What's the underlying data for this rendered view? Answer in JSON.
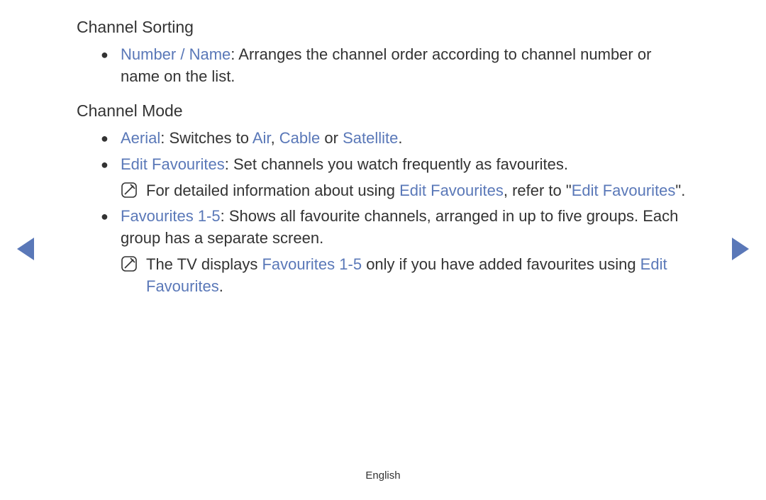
{
  "section1": {
    "heading": "Channel Sorting",
    "item1": {
      "label": "Number / Name",
      "text": ": Arranges the channel order according to channel number or name on the list."
    }
  },
  "section2": {
    "heading": "Channel Mode",
    "aerial": {
      "label": "Aerial",
      "t1": ": Switches to ",
      "opt1": "Air",
      "sep1": ", ",
      "opt2": "Cable",
      "sep2": " or ",
      "opt3": "Satellite",
      "tail": "."
    },
    "editfav": {
      "label": "Edit Favourites",
      "text": ": Set channels you watch frequently as favourites."
    },
    "note1": {
      "t1": "For detailed information about using ",
      "hl1": "Edit Favourites",
      "t2": ", refer to \"",
      "hl2": "Edit Favourites",
      "t3": "\"."
    },
    "fav15": {
      "label": "Favourites 1-5",
      "text": ": Shows all favourite channels, arranged in up to five groups. Each group has a separate screen."
    },
    "note2": {
      "t1": "The TV displays ",
      "hl1": "Favourites 1-5",
      "t2": " only if you have added favourites using ",
      "hl2": "Edit Favourites",
      "t3": "."
    }
  },
  "footer": {
    "language": "English"
  }
}
